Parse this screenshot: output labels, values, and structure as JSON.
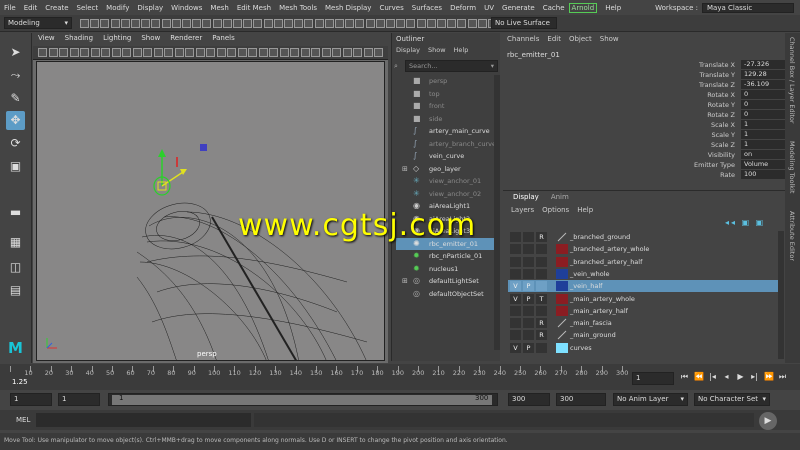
{
  "menubar": {
    "items": [
      "File",
      "Edit",
      "Create",
      "Select",
      "Modify",
      "Display",
      "Windows",
      "Mesh",
      "Edit Mesh",
      "Mesh Tools",
      "Mesh Display",
      "Curves",
      "Surfaces",
      "Deform",
      "UV",
      "Generate",
      "Cache"
    ],
    "arnold": "Arnold",
    "help": "Help",
    "workspace_label": "Workspace :",
    "workspace_value": "Maya Classic"
  },
  "shelf": {
    "mode": "Modeling",
    "live_surface": "No Live Surface"
  },
  "viewport": {
    "menu": [
      "View",
      "Shading",
      "Lighting",
      "Show",
      "Renderer",
      "Panels"
    ],
    "camera_label": "persp"
  },
  "outliner": {
    "title": "Outliner",
    "menu": [
      "Display",
      "Show",
      "Help"
    ],
    "search_placeholder": "Search...",
    "items": [
      {
        "label": "persp",
        "dim": true,
        "icon": "camera-icon",
        "expand": ""
      },
      {
        "label": "top",
        "dim": true,
        "icon": "camera-icon",
        "expand": ""
      },
      {
        "label": "front",
        "dim": true,
        "icon": "camera-icon",
        "expand": ""
      },
      {
        "label": "side",
        "dim": true,
        "icon": "camera-icon",
        "expand": ""
      },
      {
        "label": "artery_main_curve",
        "dim": false,
        "icon": "curve-icon",
        "expand": ""
      },
      {
        "label": "artery_branch_curve",
        "dim": true,
        "icon": "curve-icon",
        "expand": ""
      },
      {
        "label": "vein_curve",
        "dim": false,
        "icon": "curve-icon",
        "expand": ""
      },
      {
        "label": "geo_layer",
        "dim": false,
        "icon": "group-icon",
        "expand": "+"
      },
      {
        "label": "view_anchor_01",
        "dim": true,
        "icon": "locator-icon",
        "expand": ""
      },
      {
        "label": "view_anchor_02",
        "dim": true,
        "icon": "locator-icon",
        "expand": ""
      },
      {
        "label": "aiAreaLight1",
        "dim": false,
        "icon": "light-icon",
        "expand": ""
      },
      {
        "label": "aiAreaLight2",
        "dim": false,
        "icon": "light-icon",
        "expand": ""
      },
      {
        "label": "aiAreaLight3",
        "dim": false,
        "icon": "light-icon",
        "expand": ""
      },
      {
        "label": "rbc_emitter_01",
        "dim": false,
        "icon": "emitter-icon",
        "expand": "",
        "selected": true
      },
      {
        "label": "rbc_nParticle_01",
        "dim": false,
        "icon": "particle-icon",
        "expand": ""
      },
      {
        "label": "nucleus1",
        "dim": false,
        "icon": "nucleus-icon",
        "expand": ""
      },
      {
        "label": "defaultLightSet",
        "dim": false,
        "icon": "set-icon",
        "expand": "+"
      },
      {
        "label": "defaultObjectSet",
        "dim": false,
        "icon": "set-icon",
        "expand": ""
      }
    ]
  },
  "channelbox": {
    "menu": [
      "Channels",
      "Edit",
      "Object",
      "Show"
    ],
    "object": "rbc_emitter_01",
    "rows": [
      {
        "label": "Translate X",
        "value": "-27.326"
      },
      {
        "label": "Translate Y",
        "value": "129.28"
      },
      {
        "label": "Translate Z",
        "value": "-36.109"
      },
      {
        "label": "Rotate X",
        "value": "0"
      },
      {
        "label": "Rotate Y",
        "value": "0"
      },
      {
        "label": "Rotate Z",
        "value": "0"
      },
      {
        "label": "Scale X",
        "value": "1"
      },
      {
        "label": "Scale Y",
        "value": "1"
      },
      {
        "label": "Scale Z",
        "value": "1"
      },
      {
        "label": "Visibility",
        "value": "on"
      },
      {
        "label": "Emitter Type",
        "value": "Volume"
      },
      {
        "label": "Rate",
        "value": "100"
      }
    ]
  },
  "layers": {
    "tabs": [
      "Display",
      "Anim"
    ],
    "menu": [
      "Layers",
      "Options",
      "Help"
    ],
    "rows": [
      {
        "v": "",
        "p": "",
        "r": "R",
        "name": "_branched_ground",
        "color": "",
        "wire": true
      },
      {
        "v": "",
        "p": "",
        "r": "",
        "name": "_branched_artery_whole",
        "color": "#8b1d22",
        "wire": false
      },
      {
        "v": "",
        "p": "",
        "r": "",
        "name": "_branched_artery_half",
        "color": "#8b1d22",
        "wire": false
      },
      {
        "v": "",
        "p": "",
        "r": "",
        "name": "_vein_whole",
        "color": "#1f3f9a",
        "wire": false
      },
      {
        "v": "V",
        "p": "P",
        "r": "",
        "name": "_vein_half",
        "color": "#1f3f9a",
        "wire": false,
        "selected": true
      },
      {
        "v": "V",
        "p": "P",
        "r": "T",
        "name": "_main_artery_whole",
        "color": "#8b1d22",
        "wire": false
      },
      {
        "v": "",
        "p": "",
        "r": "",
        "name": "_main_artery_half",
        "color": "#8b1d22",
        "wire": false
      },
      {
        "v": "",
        "p": "",
        "r": "R",
        "name": "_main_fascia",
        "color": "",
        "wire": true
      },
      {
        "v": "",
        "p": "",
        "r": "R",
        "name": "_main_ground",
        "color": "",
        "wire": true
      },
      {
        "v": "V",
        "p": "P",
        "r": "",
        "name": "curves",
        "color": "#7ee0ff",
        "wire": false
      }
    ]
  },
  "sidetabs": [
    "Channel Box / Layer Editor",
    "Modeling Toolkit",
    "Attribute Editor"
  ],
  "timeline": {
    "ticks": [
      "1",
      "10",
      "20",
      "30",
      "40",
      "50",
      "60",
      "70",
      "80",
      "90",
      "100",
      "110",
      "120",
      "130",
      "140",
      "150",
      "160",
      "170",
      "180",
      "190",
      "200",
      "210",
      "220",
      "230",
      "240",
      "250",
      "260",
      "270",
      "280",
      "290",
      "300"
    ],
    "current_left": "1.25",
    "current_frame": "1"
  },
  "range": {
    "start": "1",
    "start2": "1",
    "slider_start": "1",
    "slider_end": "300",
    "end": "300",
    "end2": "300",
    "anim_layer": "No Anim Layer",
    "character_set": "No Character Set"
  },
  "cmd": {
    "label": "MEL"
  },
  "help_text": "Move Tool: Use manipulator to move object(s). Ctrl+MMB+drag to move components along normals. Use D or INSERT to change the pivot position and axis orientation.",
  "watermark": "www.cgtsj.com"
}
